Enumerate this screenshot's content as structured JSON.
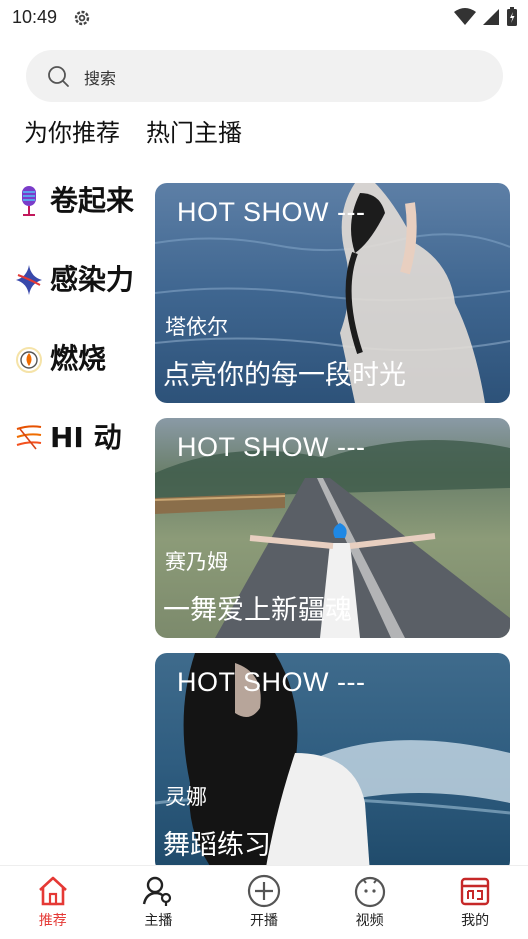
{
  "status": {
    "time": "10:49"
  },
  "search": {
    "placeholder": "搜索"
  },
  "tabs": [
    {
      "label": "为你推荐"
    },
    {
      "label": "热门主播"
    }
  ],
  "categories": [
    {
      "label": "卷起来",
      "icon": "microphone-icon"
    },
    {
      "label": "感染力",
      "icon": "spark-icon"
    },
    {
      "label": "燃烧",
      "icon": "flame-icon"
    },
    {
      "label": "HI 动",
      "icon": "wave-icon"
    }
  ],
  "cards": [
    {
      "tag": "HOT SHOW ---",
      "name": "塔依尔",
      "title": "点亮你的每一段时光",
      "scene": "lake"
    },
    {
      "tag": "HOT SHOW ---",
      "name": "赛乃姆",
      "title": "一舞爱上新疆魂",
      "scene": "road"
    },
    {
      "tag": "HOT SHOW ---",
      "name": "灵娜",
      "title": "舞蹈练习",
      "scene": "sea"
    }
  ],
  "bottom_nav": [
    {
      "label": "推荐",
      "icon": "home-icon",
      "active": true
    },
    {
      "label": "主播",
      "icon": "anchor-icon",
      "active": false
    },
    {
      "label": "开播",
      "icon": "plus-circle-icon",
      "active": false
    },
    {
      "label": "视频",
      "icon": "video-face-icon",
      "active": false
    },
    {
      "label": "我的",
      "icon": "profile-icon",
      "active": false
    }
  ],
  "colors": {
    "accent": "#e53935",
    "search_bg": "#f1f1f1"
  }
}
